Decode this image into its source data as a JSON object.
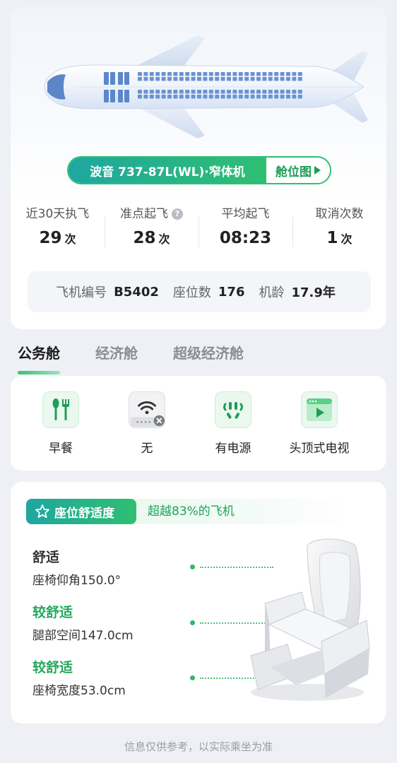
{
  "aircraft": {
    "model": "波音 737-87L(WL)·窄体机",
    "seatmap_label": "舱位图"
  },
  "stats": [
    {
      "label": "近30天执飞",
      "value": "29",
      "unit": "次",
      "help": false
    },
    {
      "label": "准点起飞",
      "value": "28",
      "unit": "次",
      "help": true
    },
    {
      "label": "平均起飞",
      "value": "08:23",
      "unit": "",
      "help": false
    },
    {
      "label": "取消次数",
      "value": "1",
      "unit": "次",
      "help": false
    }
  ],
  "plane_info": {
    "reg_label": "飞机编号",
    "reg_value": "B5402",
    "seats_label": "座位数",
    "seats_value": "176",
    "age_label": "机龄",
    "age_value": "17.9年"
  },
  "tabs": [
    {
      "label": "公务舱",
      "active": true
    },
    {
      "label": "经济舱",
      "active": false
    },
    {
      "label": "超级经济舱",
      "active": false
    }
  ],
  "amenities": [
    {
      "icon": "meal-icon",
      "label": "早餐"
    },
    {
      "icon": "wifi-unavailable-icon",
      "label": "无"
    },
    {
      "icon": "power-outlet-icon",
      "label": "有电源"
    },
    {
      "icon": "overhead-tv-icon",
      "label": "头顶式电视"
    }
  ],
  "comfort": {
    "tag": "座位舒适度",
    "rank": "超越83%的飞机",
    "metrics": [
      {
        "level": "舒适",
        "detail": "座椅仰角150.0°",
        "highlight": false
      },
      {
        "level": "较舒适",
        "detail": "腿部空间147.0cm",
        "highlight": true
      },
      {
        "level": "较舒适",
        "detail": "座椅宽度53.0cm",
        "highlight": true
      }
    ]
  },
  "footer_note": "信息仅供参考，以实际乘坐为准",
  "colors": {
    "accent_green": "#2fbf71",
    "accent_teal": "#1fa6a0",
    "text_green": "#21a35c"
  }
}
